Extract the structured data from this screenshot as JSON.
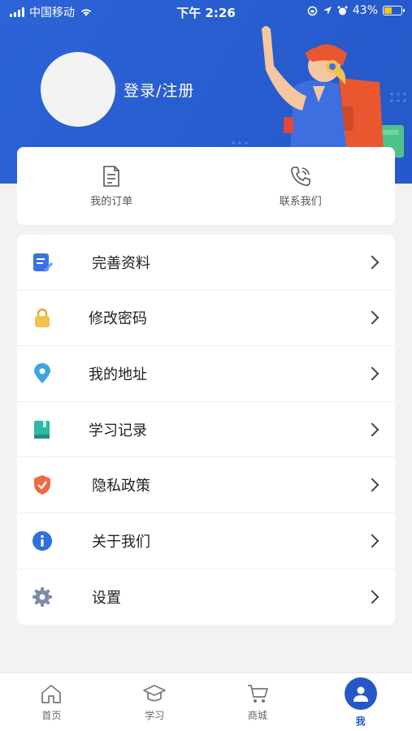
{
  "status_bar": {
    "carrier": "中国移动",
    "time": "下午 2:26",
    "battery_percent": "43%",
    "icons": [
      "signal-icon",
      "wifi-icon",
      "orientation-lock-icon",
      "location-icon",
      "alarm-icon",
      "battery-icon"
    ]
  },
  "profile": {
    "login_label": "登录/注册"
  },
  "quick_actions": [
    {
      "label": "我的订单",
      "icon": "document-icon"
    },
    {
      "label": "联系我们",
      "icon": "phone-icon"
    }
  ],
  "menu": [
    {
      "label": "完善资料",
      "icon": "edit-document-icon",
      "color": "#3a72e6"
    },
    {
      "label": "修改密码",
      "icon": "lock-icon",
      "color": "#f2c14e"
    },
    {
      "label": "我的地址",
      "icon": "location-pin-icon",
      "color": "#3aa6e0"
    },
    {
      "label": "学习记录",
      "icon": "book-icon",
      "color": "#2fb7a6"
    },
    {
      "label": "隐私政策",
      "icon": "shield-check-icon",
      "color": "#ee6a45"
    },
    {
      "label": "关于我们",
      "icon": "info-icon",
      "color": "#2f6fe0"
    },
    {
      "label": "设置",
      "icon": "gear-icon",
      "color": "#7e8aa6"
    }
  ],
  "tabbar": [
    {
      "label": "首页",
      "icon": "home-icon",
      "active": false
    },
    {
      "label": "学习",
      "icon": "graduation-cap-icon",
      "active": false
    },
    {
      "label": "商城",
      "icon": "cart-icon",
      "active": false
    },
    {
      "label": "我",
      "icon": "user-icon",
      "active": true
    }
  ],
  "colors": {
    "brand": "#2756c7",
    "page_bg": "#f2f2f2"
  }
}
